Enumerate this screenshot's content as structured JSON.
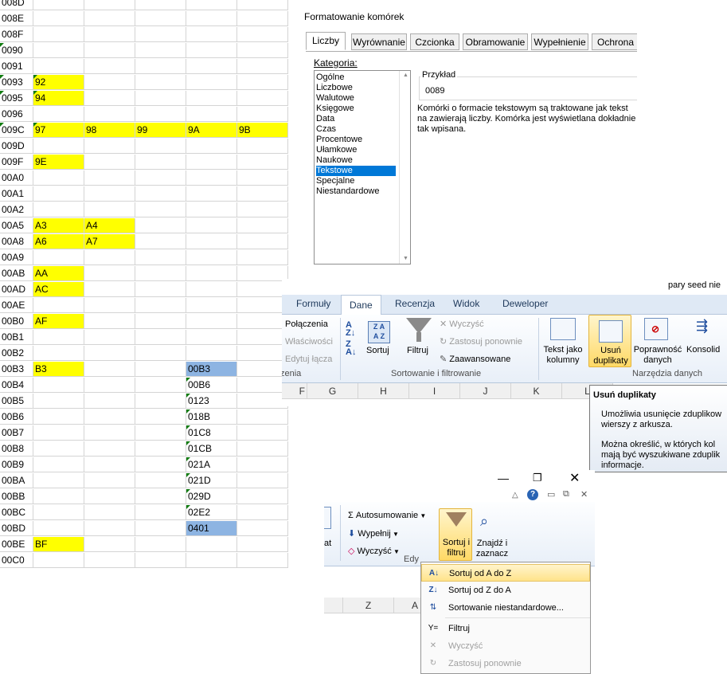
{
  "sheet": {
    "rows": [
      {
        "id": "008D",
        "cells": []
      },
      {
        "id": "008E",
        "cells": []
      },
      {
        "id": "008F",
        "cells": []
      },
      {
        "id": "0090",
        "cells": [],
        "flag": true
      },
      {
        "id": "0091",
        "cells": []
      },
      {
        "id": "0093",
        "cells": [
          {
            "col": 1,
            "v": "92",
            "hl": true
          }
        ],
        "flag": true
      },
      {
        "id": "0095",
        "cells": [
          {
            "col": 1,
            "v": "94",
            "hl": true
          }
        ],
        "flag": true
      },
      {
        "id": "0096",
        "cells": []
      },
      {
        "id": "009C",
        "cells": [
          {
            "col": 1,
            "v": "97",
            "hl": true
          },
          {
            "col": 2,
            "v": "98",
            "hl": true
          },
          {
            "col": 3,
            "v": "99",
            "hl": true
          },
          {
            "col": 4,
            "v": "9A",
            "hl": true
          },
          {
            "col": 5,
            "v": "9B",
            "hl": true
          }
        ],
        "flag": true
      },
      {
        "id": "009D",
        "cells": []
      },
      {
        "id": "009F",
        "cells": [
          {
            "col": 1,
            "v": "9E",
            "hl": true
          }
        ]
      },
      {
        "id": "00A0",
        "cells": []
      },
      {
        "id": "00A1",
        "cells": []
      },
      {
        "id": "00A2",
        "cells": []
      },
      {
        "id": "00A5",
        "cells": [
          {
            "col": 1,
            "v": "A3",
            "hl": true
          },
          {
            "col": 2,
            "v": "A4",
            "hl": true
          }
        ]
      },
      {
        "id": "00A8",
        "cells": [
          {
            "col": 1,
            "v": "A6",
            "hl": true
          },
          {
            "col": 2,
            "v": "A7",
            "hl": true
          }
        ]
      },
      {
        "id": "00A9",
        "cells": []
      },
      {
        "id": "00AB",
        "cells": [
          {
            "col": 1,
            "v": "AA",
            "hl": true
          }
        ]
      },
      {
        "id": "00AD",
        "cells": [
          {
            "col": 1,
            "v": "AC",
            "hl": true
          }
        ]
      },
      {
        "id": "00AE",
        "cells": []
      },
      {
        "id": "00B0",
        "cells": [
          {
            "col": 1,
            "v": "AF",
            "hl": true
          }
        ]
      },
      {
        "id": "00B1",
        "cells": []
      },
      {
        "id": "00B2",
        "cells": []
      },
      {
        "id": "00B3",
        "cells": [
          {
            "col": 1,
            "v": "B3",
            "hl": true
          },
          {
            "col": 4,
            "v": "00B3",
            "sel": true
          }
        ]
      },
      {
        "id": "00B4",
        "cells": [
          {
            "col": 4,
            "v": "00B6",
            "flag": true
          }
        ]
      },
      {
        "id": "00B5",
        "cells": [
          {
            "col": 4,
            "v": "0123",
            "flag": true
          }
        ]
      },
      {
        "id": "00B6",
        "cells": [
          {
            "col": 4,
            "v": "018B",
            "flag": true
          }
        ]
      },
      {
        "id": "00B7",
        "cells": [
          {
            "col": 4,
            "v": "01C8",
            "flag": true
          }
        ]
      },
      {
        "id": "00B8",
        "cells": [
          {
            "col": 4,
            "v": "01CB",
            "flag": true
          }
        ]
      },
      {
        "id": "00B9",
        "cells": [
          {
            "col": 4,
            "v": "021A",
            "flag": true
          }
        ]
      },
      {
        "id": "00BA",
        "cells": [
          {
            "col": 4,
            "v": "021D",
            "flag": true
          }
        ]
      },
      {
        "id": "00BB",
        "cells": [
          {
            "col": 4,
            "v": "029D",
            "flag": true
          }
        ]
      },
      {
        "id": "00BC",
        "cells": [
          {
            "col": 4,
            "v": "02E2",
            "flag": true
          }
        ]
      },
      {
        "id": "00BD",
        "cells": [
          {
            "col": 4,
            "v": "0401",
            "sel": true
          }
        ]
      },
      {
        "id": "00BE",
        "cells": [
          {
            "col": 1,
            "v": "BF",
            "hl": true
          }
        ]
      },
      {
        "id": "00C0",
        "cells": []
      }
    ]
  },
  "format_dialog": {
    "title": "Formatowanie komórek",
    "tabs": [
      "Liczby",
      "Wyrównanie",
      "Czcionka",
      "Obramowanie",
      "Wypełnienie",
      "Ochrona"
    ],
    "category_label": "Kategoria:",
    "categories": [
      "Ogólne",
      "Liczbowe",
      "Walutowe",
      "Księgowe",
      "Data",
      "Czas",
      "Procentowe",
      "Ułamkowe",
      "Naukowe",
      "Tekstowe",
      "Specjalne",
      "Niestandardowe"
    ],
    "selected_category": "Tekstowe",
    "sample_label": "Przykład",
    "sample_value": "0089",
    "description": "Komórki o formacie tekstowym są traktowane jak tekst na zawierają liczby. Komórka jest wyświetlana dokładnie tak wpisana."
  },
  "ribbon": {
    "top_text": "pary seed nie",
    "tabs": [
      "Formuły",
      "Dane",
      "Recenzja",
      "Widok",
      "Deweloper"
    ],
    "active_tab": "Dane",
    "connections": {
      "items": [
        "Połączenia",
        "Właściwości",
        "Edytuj łącza"
      ],
      "group": "zenia"
    },
    "sort_filter": {
      "sort_label": "Sortuj",
      "filter_label": "Filtruj",
      "clear": "Wyczyść",
      "reapply": "Zastosuj ponownie",
      "advanced": "Zaawansowane",
      "group": "Sortowanie i filtrowanie"
    },
    "data_tools": {
      "text_to_cols": "Tekst jako kolumny",
      "remove_dup": "Usuń duplikaty",
      "validation": "Poprawność danych",
      "consolidate": "Konsolid",
      "group": "Narzędzia danych"
    },
    "columns": [
      "F",
      "G",
      "H",
      "I",
      "J",
      "K",
      "L"
    ],
    "tooltip": {
      "title": "Usuń duplikaty",
      "line1": "Umożliwia usunięcie zduplikow wierszy z arkusza.",
      "line2": "Można określić, w których kol mają być wyszukiwane zduplik informacje."
    }
  },
  "sort_window": {
    "autosum": "Autosumowanie",
    "fill": "Wypełnij",
    "clear": "Wyczyść",
    "at": "at",
    "edit_group": "Edy",
    "sort_filter": "Sortuj i filtruj",
    "find_select": "Znajdź i zaznacz",
    "columns": [
      "Z",
      "A"
    ],
    "menu": [
      "Sortuj od A do Z",
      "Sortuj od Z do A",
      "Sortowanie niestandardowe...",
      "Filtruj",
      "Wyczyść",
      "Zastosuj ponownie"
    ]
  }
}
